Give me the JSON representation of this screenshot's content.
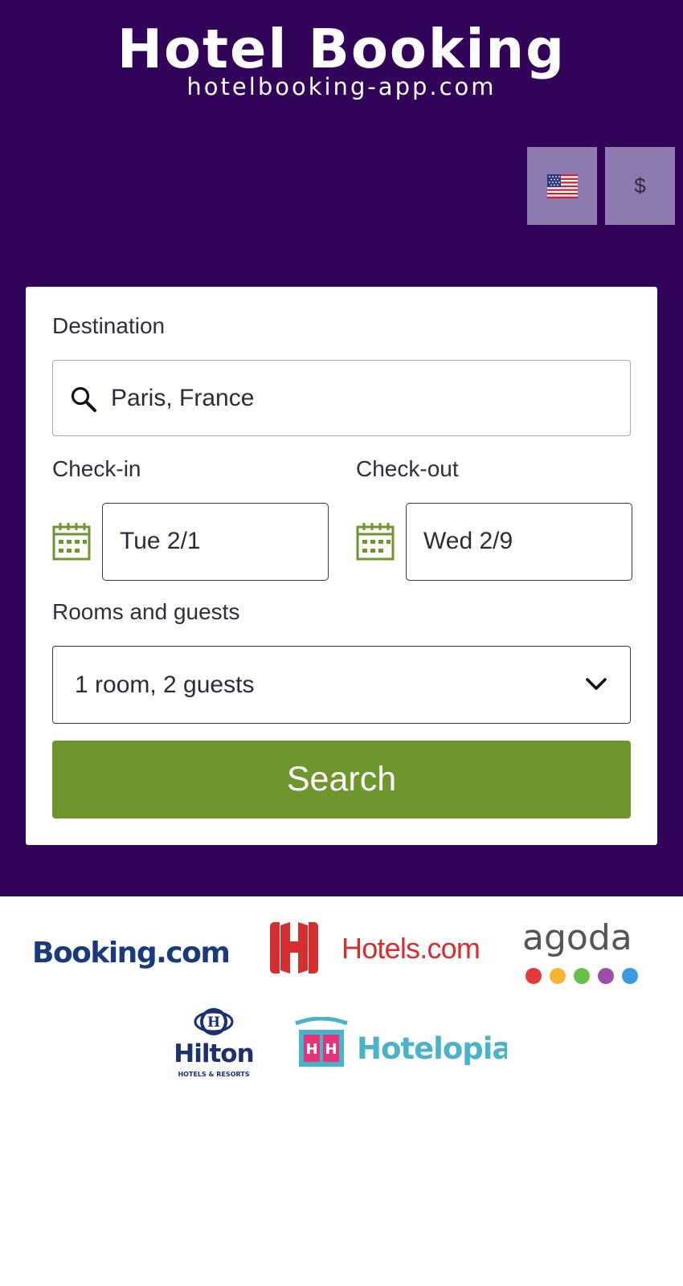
{
  "brand": {
    "title": "Hotel Booking",
    "subtitle": "hotelbooking-app.com"
  },
  "preferences": {
    "language_icon": "us-flag-icon",
    "currency_label": "$"
  },
  "search_form": {
    "destination_label": "Destination",
    "destination_value": "Paris, France",
    "checkin_label": "Check-in",
    "checkin_value": "Tue 2/1",
    "checkout_label": "Check-out",
    "checkout_value": "Wed 2/9",
    "rooms_label": "Rooms and guests",
    "rooms_value": "1 room, 2 guests",
    "search_button": "Search"
  },
  "partners": [
    {
      "name": "Booking.com"
    },
    {
      "name": "Hotels.com"
    },
    {
      "name": "agoda"
    },
    {
      "name": "Hilton",
      "tagline": "HOTELS & RESORTS"
    },
    {
      "name": "Hotelopia"
    }
  ],
  "colors": {
    "background": "#310459",
    "accent": "#6f962e",
    "pref_button": "#8d7aae",
    "card": "#ffffff"
  }
}
